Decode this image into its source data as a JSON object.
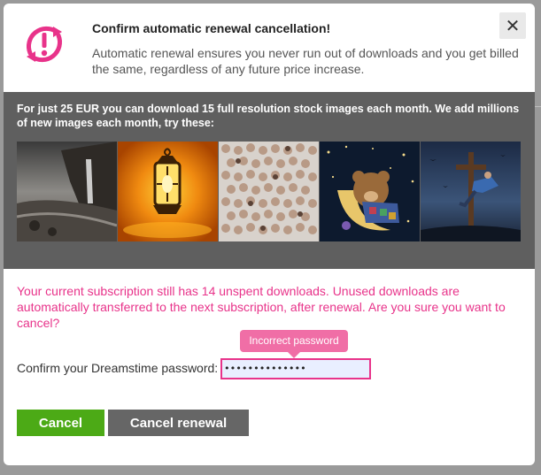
{
  "dialog": {
    "title": "Confirm automatic renewal cancellation!",
    "description": "Automatic renewal ensures you never run out of downloads and you get billed the same, regardless of any future price increase.",
    "close_label": "✕",
    "icon": "refresh-alert-icon"
  },
  "promo": {
    "text": "For just 25 EUR you can download 15 full resolution stock images each month. We add millions of new images each month, try these:",
    "images": [
      {
        "name": "coastal-waterfall-image"
      },
      {
        "name": "glowing-lantern-image"
      },
      {
        "name": "faces-collage-image"
      },
      {
        "name": "teddy-bear-moon-image"
      },
      {
        "name": "surreal-cross-figure-image"
      }
    ]
  },
  "warning": {
    "text": "Your current subscription still has 14 unspent downloads. Unused downloads are automatically transferred to the next subscription, after renewal. Are you sure you want to cancel?"
  },
  "password": {
    "label": "Confirm your Dreamstime password:",
    "value": "••••••••••••••",
    "error": "Incorrect password"
  },
  "buttons": {
    "cancel": "Cancel",
    "cancel_renewal": "Cancel renewal"
  },
  "colors": {
    "accent_pink": "#e8338a",
    "cancel_green": "#4caa16",
    "renewal_gray": "#666666",
    "promo_bg": "#5f5f5f"
  }
}
